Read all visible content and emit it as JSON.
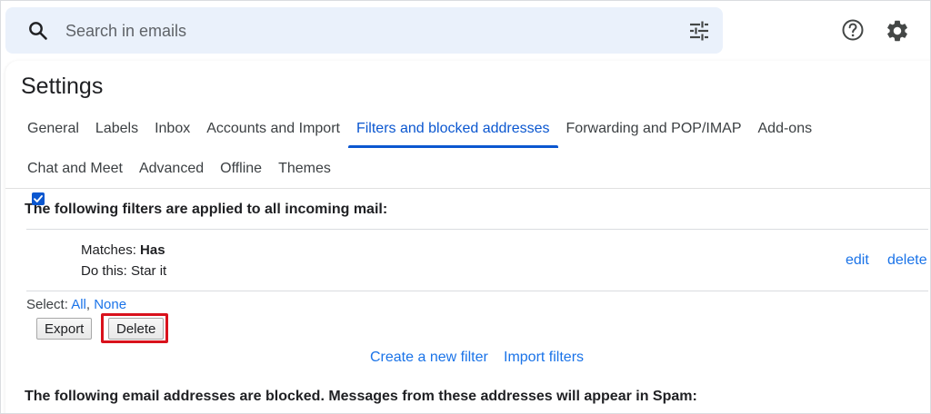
{
  "search": {
    "placeholder": "Search in emails"
  },
  "settings": {
    "title": "Settings",
    "tabs_row1": [
      "General",
      "Labels",
      "Inbox",
      "Accounts and Import",
      "Filters and blocked addresses",
      "Forwarding and POP/IMAP",
      "Add-ons"
    ],
    "tabs_row2": [
      "Chat and Meet",
      "Advanced",
      "Offline",
      "Themes"
    ],
    "active_tab": "Filters and blocked addresses"
  },
  "filters": {
    "heading": "The following filters are applied to all incoming mail:",
    "items": [
      {
        "matches_label": "Matches: ",
        "matches_value": "Has",
        "action": "Do this: Star it",
        "checked": true,
        "edit_label": "edit",
        "delete_label": "delete"
      }
    ],
    "select_label": "Select: ",
    "select_all": "All",
    "select_sep": ", ",
    "select_none": "None",
    "export_label": "Export",
    "delete_label": "Delete",
    "create_filter_label": "Create a new filter",
    "import_filters_label": "Import filters"
  },
  "blocked": {
    "heading": "The following email addresses are blocked. Messages from these addresses will appear in Spam:"
  },
  "colors": {
    "accent": "#0b57d0",
    "link": "#1a73e8",
    "search_bg": "#eaf1fb",
    "highlight": "#d9121c"
  }
}
